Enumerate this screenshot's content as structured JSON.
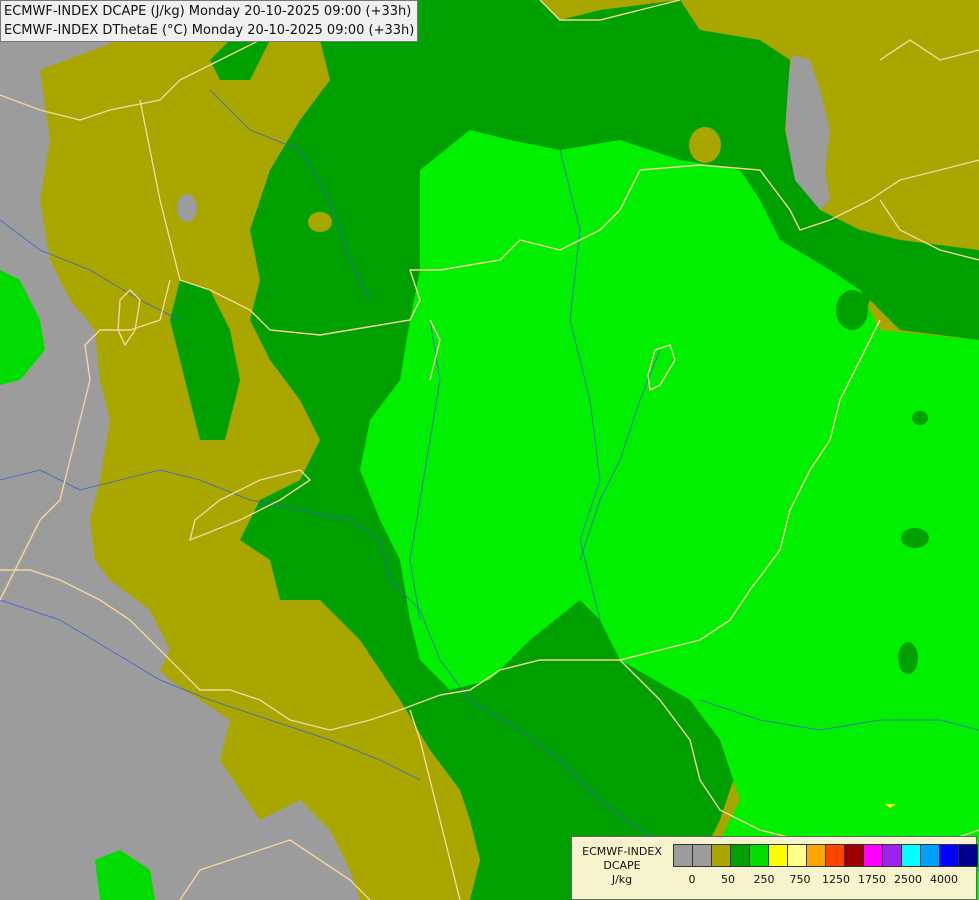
{
  "title_lines": [
    "ECMWF-INDEX DCAPE (J/kg) Monday 20-10-2025 09:00 (+33h)",
    "ECMWF-INDEX DThetaE (°C) Monday 20-10-2025 09:00 (+33h)"
  ],
  "legend": {
    "line1": "ECMWF-INDEX",
    "line2": "DCAPE",
    "line3": "J/kg",
    "colors": [
      "#9c9c9c",
      "#9c9c9c",
      "#aaa600",
      "#00a000",
      "#00dc00",
      "#ffff00",
      "#ffff8c",
      "#ffa500",
      "#ff4500",
      "#a00000",
      "#ff00ff",
      "#a020f0",
      "#00ffff",
      "#00a0ff",
      "#0000ff",
      "#00008c"
    ],
    "tick_labels": [
      "0",
      "50",
      "250",
      "750",
      "1250",
      "1750",
      "2500",
      "4000"
    ]
  },
  "colors": {
    "gray": "#9c9c9c",
    "olive": "#aaa600",
    "dark_green": "#00a000",
    "light_green": "#00f000",
    "border": "#f5d5a0",
    "river": "#3a64c8"
  }
}
